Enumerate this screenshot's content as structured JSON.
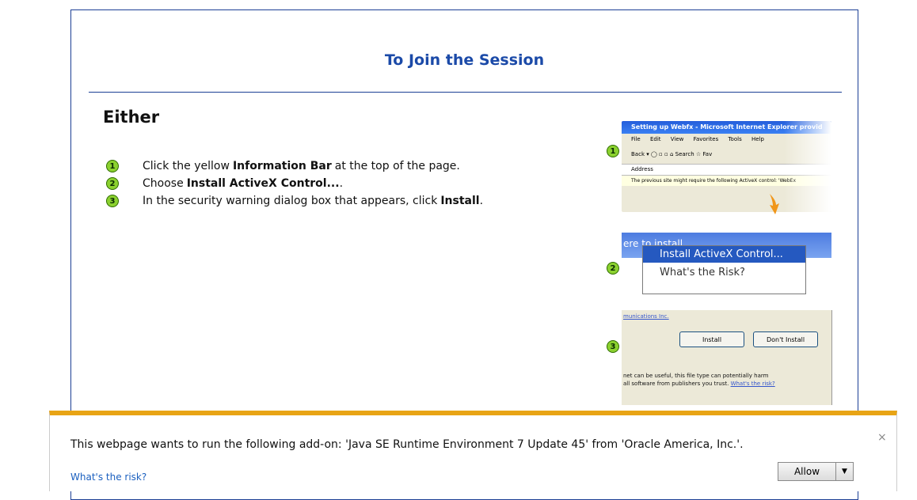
{
  "panel": {
    "title": "To Join the Session",
    "either": "Either",
    "steps": [
      {
        "num": "1",
        "pre": "Click the yellow",
        "bold": "Information Bar",
        "post": "at the top of the page."
      },
      {
        "num": "2",
        "pre": "Choose",
        "bold": "Install ActiveX Control...",
        "post": "."
      },
      {
        "num": "3",
        "pre": "In the security warning dialog box that appears, click",
        "bold": "Install",
        "post": "."
      }
    ]
  },
  "screenshots": {
    "shot1": {
      "title": "Setting up Webfx - Microsoft Internet Explorer provid",
      "menu": [
        "File",
        "Edit",
        "View",
        "Favorites",
        "Tools",
        "Help"
      ],
      "toolbar": "Back ▾  ◯  ▫  ▫  ⌂  Search  ☆ Fav",
      "address": "Address",
      "info": "The previous site might require the following ActiveX control: 'WebEx"
    },
    "shot2": {
      "bar_text": "ere to install...",
      "item1": "Install ActiveX Control...",
      "item2": "What's the Risk?"
    },
    "shot3": {
      "top": "munications Inc.",
      "install": "Install",
      "dont_install": "Don't Install",
      "line1": "net can be useful, this file type can potentially harm",
      "line2": "all software from publishers you trust.",
      "risk_link": "What's the risk?"
    },
    "badges": [
      "1",
      "2",
      "3"
    ]
  },
  "notification": {
    "message": "This webpage wants to run the following add-on: 'Java SE Runtime Environment 7 Update 45' from 'Oracle America, Inc.'.",
    "link": "What's the risk?",
    "allow": "Allow",
    "close": "×",
    "dropdown": "▼"
  },
  "colors": {
    "accent_blue": "#1b4aa8",
    "badge_green": "#8bd12f",
    "notif_border": "#e8a415",
    "link": "#1a5fbf"
  }
}
